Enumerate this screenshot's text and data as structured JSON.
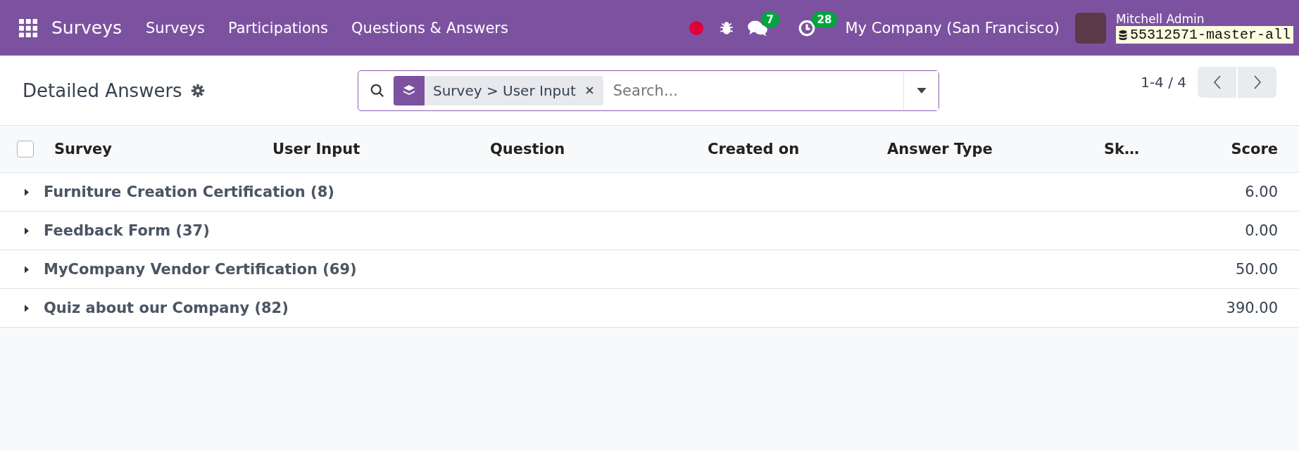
{
  "navbar": {
    "app_name": "Surveys",
    "menu": [
      "Surveys",
      "Participations",
      "Questions & Answers"
    ],
    "chat_count": "7",
    "activity_count": "28",
    "company": "My Company (San Francisco)",
    "user": "Mitchell Admin",
    "database": "55312571-master-all"
  },
  "control_panel": {
    "title": "Detailed Answers",
    "facet": {
      "label": "Survey > User Input"
    },
    "search": {
      "placeholder": "Search..."
    },
    "pager": "1-4 / 4"
  },
  "table": {
    "select_all": {
      "checked": false
    },
    "columns": [
      "Survey",
      "User Input",
      "Question",
      "Created on",
      "Answer Type",
      "Sk…",
      "Score"
    ],
    "groups": [
      {
        "name": "Furniture Creation Certification (8)",
        "expanded": false,
        "score": "6.00"
      },
      {
        "name": "Feedback Form (37)",
        "expanded": false,
        "score": "0.00"
      },
      {
        "name": "MyCompany Vendor Certification (69)",
        "expanded": false,
        "score": "50.00"
      },
      {
        "name": "Quiz about our Company (82)",
        "expanded": false,
        "score": "390.00"
      }
    ]
  }
}
